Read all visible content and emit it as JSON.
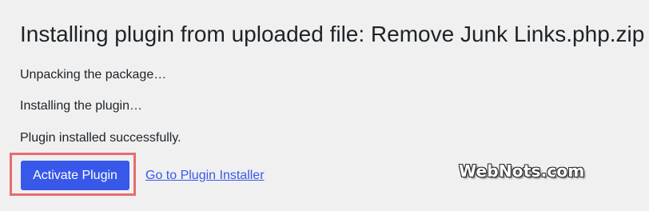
{
  "page": {
    "title": "Installing plugin from uploaded file: Remove Junk Links.php.zip"
  },
  "log": [
    "Unpacking the package…",
    "Installing the plugin…",
    "Plugin installed successfully."
  ],
  "actions": {
    "activate_label": "Activate Plugin",
    "installer_link_label": "Go to Plugin Installer"
  },
  "watermark": "WebNots.com",
  "colors": {
    "background": "#f0f0f1",
    "accent": "#3858e9",
    "highlight": "#e86c6c",
    "text": "#1d2327"
  }
}
